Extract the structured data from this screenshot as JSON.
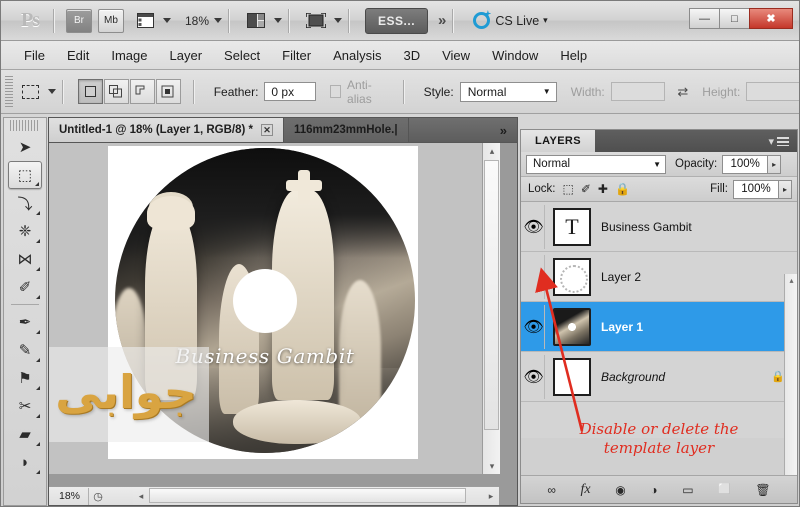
{
  "app": {
    "name": "Adobe Photoshop",
    "logo_text": "Ps"
  },
  "titlebar": {
    "bridge_label": "Br",
    "minibridge_label": "Mb",
    "extras_icon": "view-extras-icon",
    "extras_caret": "▼",
    "zoom_value": "18%",
    "zoom_caret": "▼",
    "arrange_icon": "arrange-documents-icon",
    "arrange_caret": "▼",
    "screenmode_icon": "screen-mode-icon",
    "screenmode_caret": "▼",
    "workspace_label": "ESS...",
    "workspace_more": "»",
    "cslive_label": "CS Live",
    "cslive_caret": "▾",
    "minimize_label": "—",
    "maximize_label": "□",
    "close_label": "✖"
  },
  "menubar": {
    "items": [
      {
        "label": "File"
      },
      {
        "label": "Edit"
      },
      {
        "label": "Image"
      },
      {
        "label": "Layer"
      },
      {
        "label": "Select"
      },
      {
        "label": "Filter"
      },
      {
        "label": "Analysis"
      },
      {
        "label": "3D"
      },
      {
        "label": "View"
      },
      {
        "label": "Window"
      },
      {
        "label": "Help"
      }
    ]
  },
  "options_bar": {
    "tool_icon": "rectangular-marquee-icon",
    "tool_preset_caret": "▾",
    "mode_new": "new-selection-icon",
    "mode_add": "add-to-selection-icon",
    "mode_subtract": "subtract-from-selection-icon",
    "mode_intersect": "intersect-selection-icon",
    "feather_label": "Feather:",
    "feather_value": "0 px",
    "antialias_label": "Anti-alias",
    "style_label": "Style:",
    "style_value": "Normal",
    "style_caret": "▼",
    "width_label": "Width:",
    "width_value": "",
    "swap_icon": "swap-width-height-icon",
    "height_label": "Height:",
    "height_value": ""
  },
  "toolbar": {
    "tools": [
      {
        "name": "move-tool",
        "glyph": "➤",
        "selected": false,
        "has_flyout": false
      },
      {
        "name": "rectangular-marquee-tool",
        "glyph": "⬚",
        "selected": true,
        "has_flyout": true
      },
      {
        "name": "lasso-tool",
        "glyph": "⤵",
        "selected": false,
        "has_flyout": true
      },
      {
        "name": "quick-selection-tool",
        "glyph": "❈",
        "selected": false,
        "has_flyout": true
      },
      {
        "name": "crop-tool",
        "glyph": "⋈",
        "selected": false,
        "has_flyout": true
      },
      {
        "name": "eyedropper-tool",
        "glyph": "✐",
        "selected": false,
        "has_flyout": true
      },
      {
        "name": "spot-healing-brush-tool",
        "glyph": "✒",
        "selected": false,
        "has_flyout": true
      },
      {
        "name": "brush-tool",
        "glyph": "✎",
        "selected": false,
        "has_flyout": true
      },
      {
        "name": "clone-stamp-tool",
        "glyph": "⚑",
        "selected": false,
        "has_flyout": true
      },
      {
        "name": "history-brush-tool",
        "glyph": "✂",
        "selected": false,
        "has_flyout": true
      },
      {
        "name": "eraser-tool",
        "glyph": "▰",
        "selected": false,
        "has_flyout": true
      },
      {
        "name": "paint-bucket-tool",
        "glyph": "◗",
        "selected": false,
        "has_flyout": true
      }
    ]
  },
  "document_tabs": {
    "tabs": [
      {
        "label": "Untitled-1 @ 18% (Layer 1, RGB/8) *",
        "active": true,
        "close_label": "✕"
      },
      {
        "label": "116mm23mmHole.|",
        "active": false
      }
    ],
    "overflow_label": "»"
  },
  "canvas": {
    "cd_title_text": "Business Gambit",
    "watermark_text": "جوابی",
    "image_subject": "chess-pieces-cd-label"
  },
  "document_status": {
    "zoom": "18%",
    "doc_icon": "document-info-icon",
    "scroll_left_arrow": "◂",
    "scroll_right_arrow": "▸",
    "scroll_up_arrow": "▴",
    "scroll_down_arrow": "▾"
  },
  "layers_panel": {
    "tab_label": "LAYERS",
    "menu_icon": "panel-menu-icon",
    "blend_mode": "Normal",
    "blend_caret": "▼",
    "opacity_label": "Opacity:",
    "opacity_value": "100%",
    "fill_label": "Fill:",
    "fill_value": "100%",
    "spinner_caret": "▸",
    "lock_label": "Lock:",
    "lock_icons": [
      {
        "name": "lock-transparent-pixels-icon",
        "glyph": "⬚"
      },
      {
        "name": "lock-image-pixels-icon",
        "glyph": "✐"
      },
      {
        "name": "lock-position-icon",
        "glyph": "✚"
      },
      {
        "name": "lock-all-icon",
        "glyph": "🔒"
      }
    ],
    "layers": [
      {
        "name": "Business Gambit",
        "visible": true,
        "selected": false,
        "thumb": "type-layer-thumb",
        "thumb_glyph": "T",
        "locked": false,
        "italic": false
      },
      {
        "name": "Layer 2",
        "visible": false,
        "selected": false,
        "thumb": "ring-template-thumb",
        "thumb_glyph": "",
        "locked": false,
        "italic": false
      },
      {
        "name": "Layer 1",
        "visible": true,
        "selected": true,
        "thumb": "photo-thumb",
        "thumb_glyph": "",
        "locked": false,
        "italic": false
      },
      {
        "name": "Background",
        "visible": true,
        "selected": false,
        "thumb": "blank-white-thumb",
        "thumb_glyph": "",
        "locked": true,
        "italic": true,
        "lock_glyph": "🔒"
      }
    ],
    "eye_glyph": "👁",
    "bottom_buttons": [
      {
        "name": "link-layers-button",
        "glyph": "∞"
      },
      {
        "name": "layer-style-button",
        "glyph": "fx"
      },
      {
        "name": "add-layer-mask-button",
        "glyph": "◉"
      },
      {
        "name": "adjustment-layer-button",
        "glyph": "◑"
      },
      {
        "name": "new-group-button",
        "glyph": "▭"
      },
      {
        "name": "new-layer-button",
        "glyph": "⬜"
      },
      {
        "name": "delete-layer-button",
        "glyph": "🗑"
      }
    ]
  },
  "annotation": {
    "line1": "Disable or delete the",
    "line2": "template layer",
    "color": "#e02d20",
    "arrow": "points-to-layer-2-visibility-toggle"
  }
}
